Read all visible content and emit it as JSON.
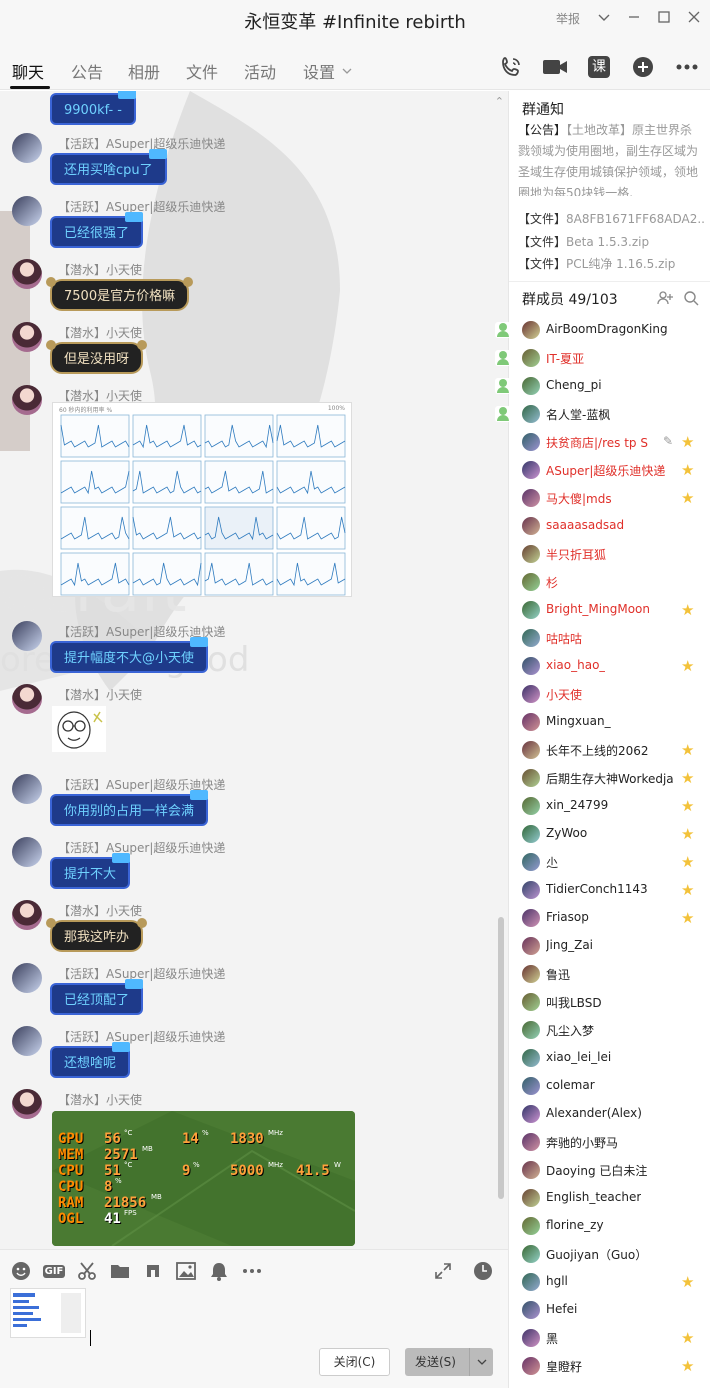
{
  "window": {
    "title": "永恒变革 #Infinite rebirth",
    "report_label": "举报"
  },
  "tabs": [
    {
      "label": "聊天"
    },
    {
      "label": "公告"
    },
    {
      "label": "相册"
    },
    {
      "label": "文件"
    },
    {
      "label": "活动"
    },
    {
      "label": "设置"
    }
  ],
  "toolbar_icons": [
    "phone-icon",
    "video-icon",
    "class-icon",
    "add-icon",
    "more-icon"
  ],
  "toolbar": {
    "class_label": "课"
  },
  "messages": [
    {
      "sender": "",
      "text": "9900kf- -",
      "style": "blue"
    },
    {
      "sender": "【活跃】ASuper|超级乐迪快递",
      "text": "还用买啥cpu了",
      "style": "blue"
    },
    {
      "sender": "【活跃】ASuper|超级乐迪快递",
      "text": "已经很强了",
      "style": "blue"
    },
    {
      "sender": "【潜水】小天使",
      "text": "7500是官方价格嘛",
      "style": "dark"
    },
    {
      "sender": "【潜水】小天使",
      "text": "但是没用呀",
      "style": "dark"
    },
    {
      "sender": "【潜水】小天使",
      "text": "",
      "style": "image"
    },
    {
      "sender": "【活跃】ASuper|超级乐迪快递",
      "text": "提升幅度不大@小天使",
      "style": "blue"
    },
    {
      "sender": "【潜水】小天使",
      "text": "",
      "style": "sticker"
    },
    {
      "sender": "【活跃】ASuper|超级乐迪快递",
      "text": "你用别的占用一样会满",
      "style": "blue"
    },
    {
      "sender": "【活跃】ASuper|超级乐迪快递",
      "text": "提升不大",
      "style": "blue"
    },
    {
      "sender": "【潜水】小天使",
      "text": "那我这咋办",
      "style": "dark"
    },
    {
      "sender": "【活跃】ASuper|超级乐迪快递",
      "text": "已经顶配了",
      "style": "blue"
    },
    {
      "sender": "【活跃】ASuper|超级乐迪快递",
      "text": "还想啥呢",
      "style": "blue"
    },
    {
      "sender": "【潜水】小天使",
      "text": "",
      "style": "image"
    }
  ],
  "graph_image": {
    "header_left": "60 秒内的利用率 %",
    "header_right": "100%"
  },
  "stats_image": {
    "rows": [
      {
        "label": "GPU",
        "v1": "56",
        "u1": "°C",
        "v2": "14",
        "u2": "%",
        "v3": "1830",
        "u3": "MHz"
      },
      {
        "label": "MEM",
        "v1": "2571",
        "u1": "MB",
        "v2": "",
        "u2": "",
        "v3": "",
        "u3": ""
      },
      {
        "label": "CPU",
        "v1": "51",
        "u1": "°C",
        "v2": "9",
        "u2": "%",
        "v3": "5000",
        "u3": "MHz",
        "v4": "41.5",
        "u4": "W"
      },
      {
        "label": "CPU",
        "v1": "8",
        "u1": "%",
        "v2": "",
        "u2": "",
        "v3": "",
        "u3": ""
      },
      {
        "label": "RAM",
        "v1": "21856",
        "u1": "MB",
        "v2": "",
        "u2": "",
        "v3": "",
        "u3": ""
      },
      {
        "label": "OGL",
        "v1": "41",
        "u1": "FPS",
        "v2": "",
        "u2": "",
        "v3": "",
        "u3": ""
      }
    ]
  },
  "input": {
    "icons": [
      "emoji-icon",
      "gif-icon",
      "scissors-icon",
      "folder-icon",
      "music-icon",
      "image-icon",
      "bell-icon",
      "more-icon"
    ],
    "gif_label": "GIF",
    "close_label": "关闭(C)",
    "send_label": "发送(S)"
  },
  "notice": {
    "title": "群通知",
    "tag": "【公告】",
    "bracket": "【土地改革】",
    "text": "原主世界杀戮领域为使用圈地，副生存区域为圣域生存使用城镇保护领域，领地圈地为每50块钱一格."
  },
  "files": [
    {
      "tag": "【文件】",
      "name": "8A8FB1671FF68ADA2..."
    },
    {
      "tag": "【文件】",
      "name": "Beta 1.5.3.zip"
    },
    {
      "tag": "【文件】",
      "name": "PCL纯净 1.16.5.zip"
    }
  ],
  "members": {
    "title": "群成员 49/103",
    "list": [
      {
        "name": "AirBoomDragonKing",
        "color": "#222222",
        "badge": "admin"
      },
      {
        "name": "IT-夏亚",
        "color": "#e0302a",
        "badge": "admin"
      },
      {
        "name": "Cheng_pi",
        "color": "#222222",
        "badge": "admin"
      },
      {
        "name": "名人堂-蓝枫",
        "color": "#222222",
        "badge": "admin"
      },
      {
        "name": "扶贫商店|/res tp S",
        "color": "#e0302a",
        "badge": "star",
        "edit": true
      },
      {
        "name": "ASuper|超级乐迪快递",
        "color": "#e0302a",
        "badge": "star"
      },
      {
        "name": "马大傻|mds",
        "color": "#e0302a",
        "badge": "star"
      },
      {
        "name": "saaaasadsad",
        "color": "#e0302a",
        "badge": ""
      },
      {
        "name": "半只折耳狐",
        "color": "#e0302a",
        "badge": ""
      },
      {
        "name": "杉",
        "color": "#e0302a",
        "badge": ""
      },
      {
        "name": "Bright_MingMoon",
        "color": "#e0302a",
        "badge": "star"
      },
      {
        "name": "咕咕咕",
        "color": "#e0302a",
        "badge": ""
      },
      {
        "name": "xiao_hao_",
        "color": "#e0302a",
        "badge": "star"
      },
      {
        "name": "小天使",
        "color": "#e0302a",
        "badge": ""
      },
      {
        "name": "Mingxuan_",
        "color": "#222222",
        "badge": ""
      },
      {
        "name": "长年不上线的2062",
        "color": "#222222",
        "badge": "star"
      },
      {
        "name": "后期生存大神Workedja",
        "color": "#222222",
        "badge": "star"
      },
      {
        "name": "xin_24799",
        "color": "#222222",
        "badge": "star"
      },
      {
        "name": "ZyWoo",
        "color": "#222222",
        "badge": "star"
      },
      {
        "name": "尐",
        "color": "#222222",
        "badge": "star"
      },
      {
        "name": "TidierConch1143",
        "color": "#222222",
        "badge": "star"
      },
      {
        "name": "Friasop",
        "color": "#222222",
        "badge": "star"
      },
      {
        "name": "Jing_Zai",
        "color": "#222222",
        "badge": ""
      },
      {
        "name": "鲁迅",
        "color": "#222222",
        "badge": ""
      },
      {
        "name": "叫我LBSD",
        "color": "#222222",
        "badge": ""
      },
      {
        "name": "凡尘入梦",
        "color": "#222222",
        "badge": ""
      },
      {
        "name": "xiao_lei_lei",
        "color": "#222222",
        "badge": ""
      },
      {
        "name": "colemar",
        "color": "#222222",
        "badge": ""
      },
      {
        "name": "Alexander(Alex)",
        "color": "#222222",
        "badge": ""
      },
      {
        "name": "奔驰的小野马",
        "color": "#222222",
        "badge": ""
      },
      {
        "name": "Daoying 已白未注",
        "color": "#222222",
        "badge": ""
      },
      {
        "name": "English_teacher",
        "color": "#222222",
        "badge": ""
      },
      {
        "name": "florine_zy",
        "color": "#222222",
        "badge": ""
      },
      {
        "name": "Guojiyan（Guo）",
        "color": "#222222",
        "badge": ""
      },
      {
        "name": "hgll",
        "color": "#222222",
        "badge": "star"
      },
      {
        "name": "Hefei",
        "color": "#222222",
        "badge": ""
      },
      {
        "name": "黑",
        "color": "#222222",
        "badge": "star"
      },
      {
        "name": "皇瞪籽",
        "color": "#222222",
        "badge": "star"
      }
    ]
  }
}
